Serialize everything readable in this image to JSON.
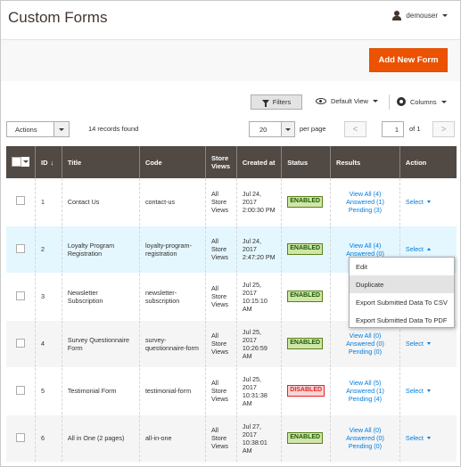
{
  "header": {
    "title": "Custom Forms",
    "user": "demouser"
  },
  "actionbar": {
    "add_label": "Add New Form"
  },
  "toolbar": {
    "filters": "Filters",
    "default_view": "Default View",
    "columns": "Columns"
  },
  "pager": {
    "actions": "Actions",
    "records": "14 records found",
    "per_page_value": "20",
    "per_page_label": "per page",
    "prev": "<",
    "page": "1",
    "of": "of 1",
    "next": ">"
  },
  "table": {
    "headers": [
      "ID",
      "Title",
      "Code",
      "Store Views",
      "Created at",
      "Status",
      "Results",
      "Action"
    ],
    "id_sort": "↓",
    "rows": [
      {
        "id": "1",
        "title": "Contact Us",
        "code": "contact-us",
        "store": "All Store Views",
        "created": "Jul 24, 2017 2:00:30 PM",
        "status": "ENABLED",
        "r1": "View All (4)",
        "r2": "Answered (1)",
        "r3": "Pending (3)",
        "action": "Select"
      },
      {
        "id": "2",
        "title": "Loyalty Program Registration",
        "code": "loyalty-program-registration",
        "store": "All Store Views",
        "created": "Jul 24, 2017 2:47:20 PM",
        "status": "ENABLED",
        "r1": "View All (4)",
        "r2": "Answered (0)",
        "r3": "",
        "action": "Select"
      },
      {
        "id": "3",
        "title": "Newsletter Subscription",
        "code": "newsletter-subscription",
        "store": "All Store Views",
        "created": "Jul 25, 2017 10:15:10 AM",
        "status": "ENABLED",
        "r1": "",
        "r2": "",
        "r3": "",
        "action": ""
      },
      {
        "id": "4",
        "title": "Survey Questionnaire Form",
        "code": "survey-questionnaire-form",
        "store": "All Store Views",
        "created": "Jul 25, 2017 10:26:59 AM",
        "status": "ENABLED",
        "r1": "View All (0)",
        "r2": "Answered (0)",
        "r3": "Pending (0)",
        "action": "Select"
      },
      {
        "id": "5",
        "title": "Testimonial Form",
        "code": "testimonial-form",
        "store": "All Store Views",
        "created": "Jul 25, 2017 10:31:38 AM",
        "status": "DISABLED",
        "r1": "View All (5)",
        "r2": "Answered (1)",
        "r3": "Pending (4)",
        "action": "Select"
      },
      {
        "id": "6",
        "title": "All in One (2 pages)",
        "code": "all-in-one",
        "store": "All Store Views",
        "created": "Jul 27, 2017 10:38:01 AM",
        "status": "ENABLED",
        "r1": "View All (0)",
        "r2": "Answered (0)",
        "r3": "Pending (0)",
        "action": "Select"
      }
    ]
  },
  "dropdown": {
    "items": [
      "Edit",
      "Duplicate",
      "Export Submitted Data To CSV",
      "Export Submitted Data To PDF"
    ]
  },
  "colors": {
    "accent": "#eb5202",
    "header_bg": "#514943",
    "link": "#007bdb",
    "enabled": "#5b8116",
    "disabled": "#e22626"
  }
}
